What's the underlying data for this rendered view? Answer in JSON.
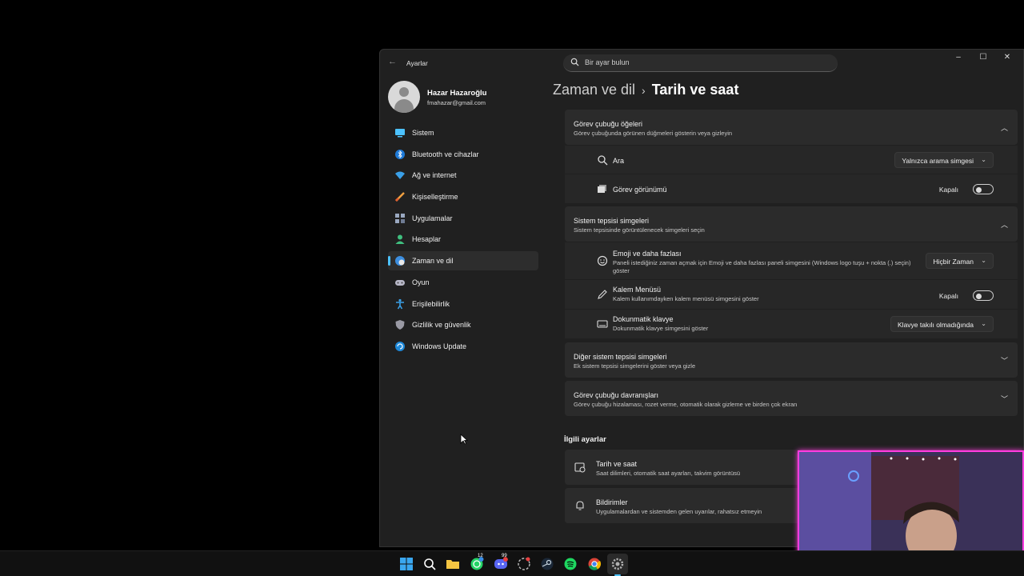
{
  "window": {
    "title": "Ayarlar",
    "search_placeholder": "Bir ayar bulun"
  },
  "profile": {
    "name": "Hazar Hazaroğlu",
    "email": "fmahazar@gmail.com"
  },
  "sidebar": {
    "items": [
      {
        "label": "Sistem",
        "icon": "monitor-icon",
        "active": false
      },
      {
        "label": "Bluetooth ve cihazlar",
        "icon": "bluetooth-icon",
        "active": false
      },
      {
        "label": "Ağ ve internet",
        "icon": "wifi-icon",
        "active": false
      },
      {
        "label": "Kişiselleştirme",
        "icon": "brush-icon",
        "active": false
      },
      {
        "label": "Uygulamalar",
        "icon": "apps-icon",
        "active": false
      },
      {
        "label": "Hesaplar",
        "icon": "person-icon",
        "active": false
      },
      {
        "label": "Zaman ve dil",
        "icon": "globe-clock-icon",
        "active": true
      },
      {
        "label": "Oyun",
        "icon": "gamepad-icon",
        "active": false
      },
      {
        "label": "Erişilebilirlik",
        "icon": "accessibility-icon",
        "active": false
      },
      {
        "label": "Gizlilik ve güvenlik",
        "icon": "shield-icon",
        "active": false
      },
      {
        "label": "Windows Update",
        "icon": "update-icon",
        "active": false
      }
    ]
  },
  "breadcrumb": {
    "parent": "Zaman ve dil",
    "separator": "›",
    "current": "Tarih ve saat"
  },
  "sections": {
    "taskbar_items": {
      "title": "Görev çubuğu öğeleri",
      "subtitle": "Görev çubuğunda görünen düğmeleri gösterin veya gizleyin",
      "rows": {
        "search": {
          "label": "Ara",
          "value": "Yalnızca arama simgesi"
        },
        "task_view": {
          "label": "Görev görünümü",
          "state": "Kapalı"
        }
      }
    },
    "tray_icons": {
      "title": "Sistem tepsisi simgeleri",
      "subtitle": "Sistem tepsisinde görüntülenecek simgeleri seçin",
      "rows": {
        "emoji": {
          "label": "Emoji ve daha fazlası",
          "desc": "Paneli istediğiniz zaman açmak için Emoji ve daha fazlası paneli simgesini (Windows logo tuşu + nokta (.) seçin) göster",
          "value": "Hiçbir Zaman"
        },
        "pen": {
          "label": "Kalem Menüsü",
          "desc": "Kalem kullanımdayken kalem menüsü simgesini göster",
          "state": "Kapalı"
        },
        "touch_kb": {
          "label": "Dokunmatik klavye",
          "desc": "Dokunmatik klavye simgesini göster",
          "value": "Klavye takılı olmadığında"
        }
      }
    },
    "other_tray": {
      "title": "Diğer sistem tepsisi simgeleri",
      "subtitle": "Ek sistem tepsisi simgelerini göster veya gizle"
    },
    "taskbar_behaviors": {
      "title": "Görev çubuğu davranışları",
      "subtitle": "Görev çubuğu hizalaması, rozet verme, otomatik olarak gizleme ve birden çok ekran"
    }
  },
  "related": {
    "title": "İlgili ayarlar",
    "items": [
      {
        "label": "Tarih ve saat",
        "desc": "Saat dilimleri, otomatik saat ayarları, takvim görüntüsü"
      },
      {
        "label": "Bildirimler",
        "desc": "Uygulamalardan ve sistemden gelen uyarılar, rahatsız etmeyin"
      }
    ]
  },
  "taskbar": {
    "apps": [
      "start-icon",
      "search-icon",
      "file-explorer-icon",
      "whatsapp-icon",
      "discord-icon",
      "app-icon",
      "steam-icon",
      "spotify-icon",
      "chrome-icon",
      "settings-icon"
    ],
    "badges": {
      "whatsapp": "12",
      "discord": "99"
    }
  },
  "colors": {
    "accent": "#4cc2ff",
    "window_bg": "#202020",
    "card_bg": "#2b2b2b",
    "webcam_border": "#ff3ce0"
  }
}
